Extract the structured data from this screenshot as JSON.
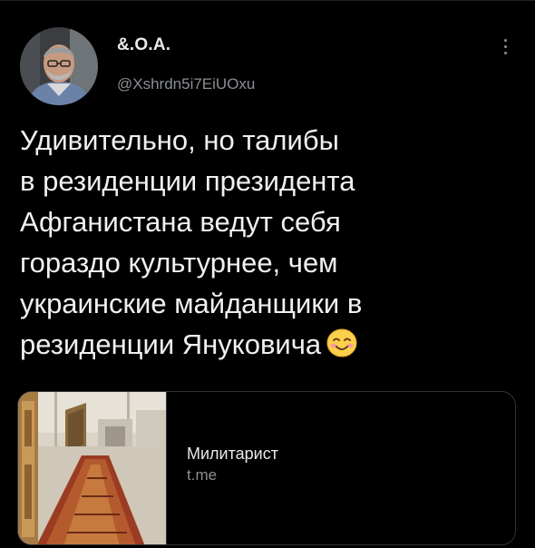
{
  "tweet": {
    "author": {
      "display_name": "&.О.А.",
      "handle": "@Xshrdn5i7EiUOxu",
      "avatar_icon": "user-avatar-photo"
    },
    "menu_icon": "more-vertical-icon",
    "text_lines": [
      "Удивительно, но талибы",
      "в резиденции президента",
      "Афганистана ведут себя",
      "гораздо культурнее, чем",
      "украинские майданщики в",
      "резиденции Януковича"
    ],
    "emoji": "smiling-face-with-smiling-eyes",
    "link_card": {
      "title": "Милитарист",
      "domain": "t.me",
      "thumbnail_icon": "palace-carpet-photo"
    }
  },
  "colors": {
    "background": "#000000",
    "text_primary": "#e7e9ea",
    "text_secondary": "#8b8f94",
    "border": "#2f3336"
  }
}
